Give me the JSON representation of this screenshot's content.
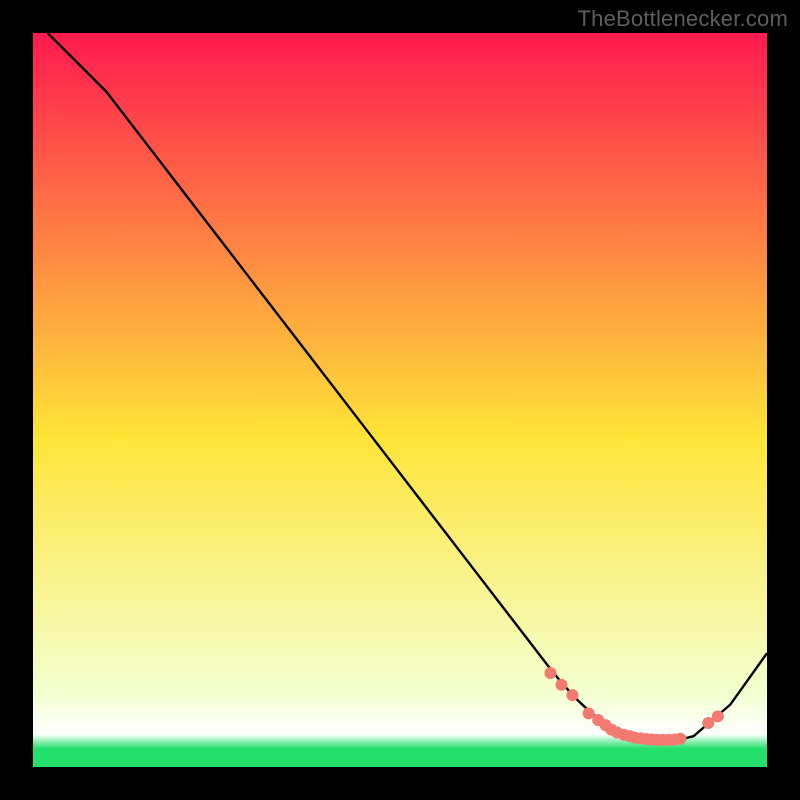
{
  "watermark": "TheBottlenecker.com",
  "colors": {
    "bg": "#000000",
    "grad_top": "#ff1a4f",
    "grad_mid": "#ffe438",
    "grad_near_bottom": "#f3ffd0",
    "grad_bottom_white": "#ffffff",
    "grad_green": "#23e06a",
    "curve": "#000000",
    "marker": "#f37a71",
    "watermark": "#5e5e5e"
  },
  "chart_data": {
    "type": "line",
    "title": "",
    "xlabel": "",
    "ylabel": "",
    "xlim": [
      0,
      100
    ],
    "ylim": [
      0,
      100
    ],
    "series": [
      {
        "name": "curve",
        "x": [
          2,
          5,
          10,
          15,
          20,
          25,
          30,
          35,
          40,
          45,
          50,
          55,
          60,
          65,
          70,
          72,
          74,
          76,
          78,
          80,
          82,
          84,
          86,
          88,
          90,
          95,
          100
        ],
        "y": [
          100,
          97,
          92,
          85.5,
          79,
          72.5,
          66,
          59.5,
          53,
          46.5,
          40,
          33.5,
          27,
          20.5,
          14,
          11.5,
          9.3,
          7.4,
          5.9,
          4.8,
          4.1,
          3.7,
          3.6,
          3.7,
          4.2,
          8.5,
          15.5
        ]
      }
    ],
    "markers": {
      "name": "highlight-points",
      "x": [
        70.5,
        72,
        73.5,
        75.7,
        77,
        78,
        78.8,
        79.6,
        80.5,
        81.3,
        82,
        82.8,
        83.6,
        84.3,
        85,
        85.8,
        86.6,
        87.4,
        88.2,
        92,
        93.3
      ],
      "y": [
        12.8,
        11.2,
        9.8,
        7.3,
        6.4,
        5.7,
        5.1,
        4.7,
        4.4,
        4.2,
        4.0,
        3.9,
        3.8,
        3.75,
        3.72,
        3.7,
        3.7,
        3.75,
        3.85,
        6.0,
        6.9
      ],
      "radius": 6
    },
    "gradient_stops": [
      {
        "offset": 0.0,
        "key": "grad_top"
      },
      {
        "offset": 0.55,
        "key": "grad_mid"
      },
      {
        "offset": 0.9,
        "key": "grad_near_bottom"
      },
      {
        "offset": 0.955,
        "key": "grad_bottom_white"
      },
      {
        "offset": 0.975,
        "key": "grad_green"
      },
      {
        "offset": 1.0,
        "key": "grad_green"
      }
    ]
  }
}
